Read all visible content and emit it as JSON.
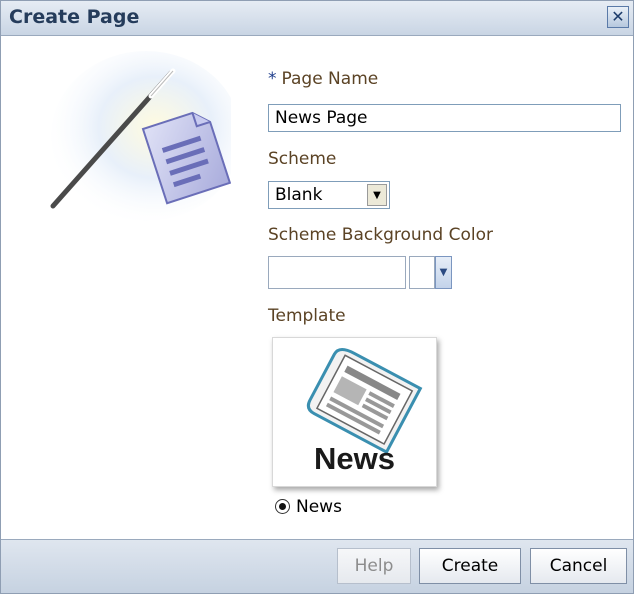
{
  "dialog": {
    "title": "Create Page",
    "close_icon": "close-icon"
  },
  "form": {
    "page_name": {
      "required_marker": "*",
      "label": "Page Name",
      "value": "News Page"
    },
    "scheme": {
      "label": "Scheme",
      "value": "Blank"
    },
    "scheme_background_color": {
      "label": "Scheme Background Color",
      "value": ""
    },
    "template": {
      "label": "Template",
      "card_text": "News",
      "option_label": "News",
      "selected": true
    }
  },
  "buttons": {
    "help": "Help",
    "create": "Create",
    "cancel": "Cancel"
  },
  "icons": {
    "wizard": "magic-wand-page-icon",
    "template": "newspaper-icon"
  }
}
